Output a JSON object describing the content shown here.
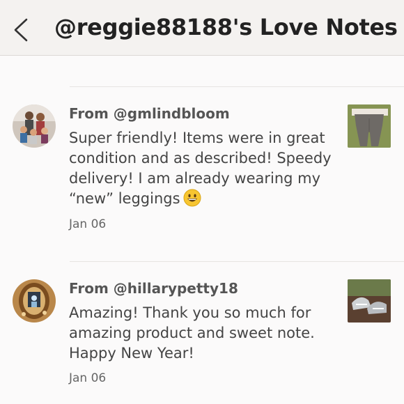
{
  "header": {
    "title": "@reggie88188's Love Notes"
  },
  "notes": [
    {
      "from": "From @gmlindbloom",
      "message": "Super friendly! Items were in great condition and as described! Speedy delivery! I am already wearing my “new” leggings",
      "emoji": "grinning-face-emoji",
      "date": "Jan 06"
    },
    {
      "from": "From @hillarypetty18",
      "message": "Amazing! Thank you so much for amazing product and sweet note. Happy New Year!",
      "date": "Jan 06"
    }
  ]
}
